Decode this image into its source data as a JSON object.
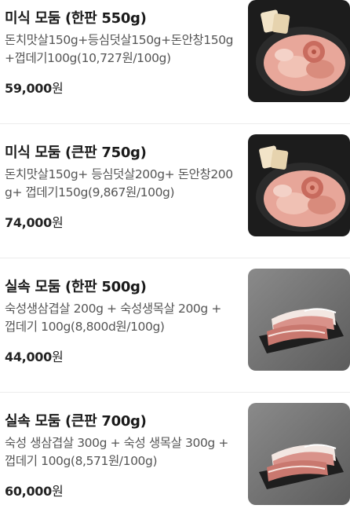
{
  "products": [
    {
      "title": "미식 모둠 (한판 550g)",
      "desc": "돈치맛살150g+등심덧살150g+돈안창150g+껍데기100g(10,727원/100g)",
      "price": "59,000",
      "currency": "원",
      "image": "slate-board-pork-rose",
      "thumb_bg": "#1f1f1f"
    },
    {
      "title": "미식 모둠 (큰판 750g)",
      "desc": "돈치맛살150g+ 등심덧살200g+ 돈안창200g+ 껍데기150g(9,867원/100g)",
      "price": "74,000",
      "currency": "원",
      "image": "slate-board-pork-rose",
      "thumb_bg": "#1f1f1f"
    },
    {
      "title": "실속 모둠 (한판 500g)",
      "desc": "숙성생삼겹살 200g + 숙성생목살 200g + 껍데기 100g(8,800d원/100g)",
      "price": "44,000",
      "currency": "원",
      "image": "slate-board-pork-belly",
      "thumb_bg": "#6f6f6f"
    },
    {
      "title": "실속 모둠 (큰판 700g)",
      "desc": "숙성 생삼겹살 300g + 숙성 생목살 300g + 껍데기 100g(8,571원/100g)",
      "price": "60,000",
      "currency": "원",
      "image": "slate-board-pork-belly",
      "thumb_bg": "#6f6f6f"
    }
  ]
}
